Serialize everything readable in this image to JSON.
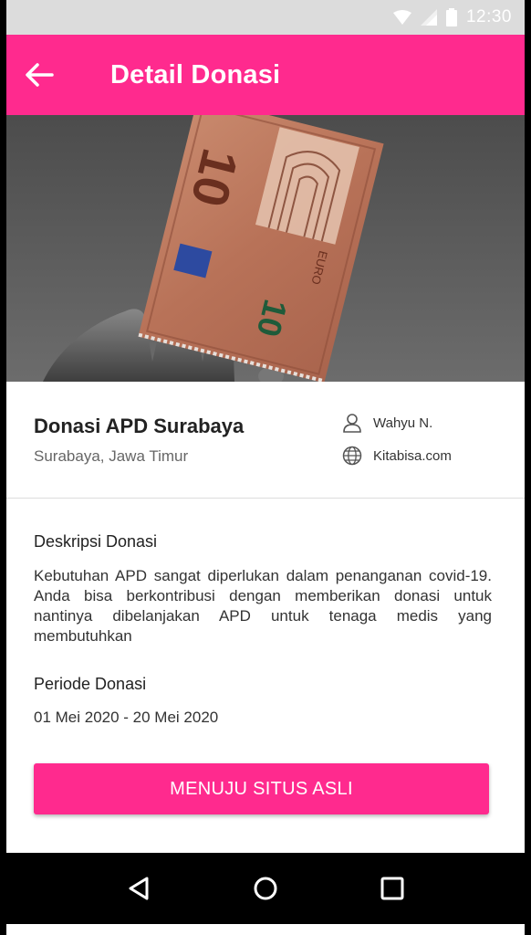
{
  "status_bar": {
    "time": "12:30"
  },
  "app_bar": {
    "title": "Detail Donasi"
  },
  "campaign": {
    "title": "Donasi APD Surabaya",
    "location": "Surabaya, Jawa Timur",
    "author": "Wahyu N.",
    "source": "Kitabisa.com"
  },
  "description": {
    "heading": "Deskripsi Donasi",
    "text": "Kebutuhan APD sangat diperlukan dalam penanganan covid-19. Anda bisa berkontribusi dengan memberikan donasi untuk nantinya dibelanjakan APD untuk tenaga medis yang membutuhkan"
  },
  "period": {
    "heading": "Periode Donasi",
    "text": "01 Mei 2020 - 20 Mei 2020"
  },
  "cta": {
    "label": "MENUJU SITUS ASLI"
  },
  "banknote": {
    "denomination": "10",
    "text": "EURO"
  },
  "colors": {
    "accent": "#ff2a8e"
  }
}
